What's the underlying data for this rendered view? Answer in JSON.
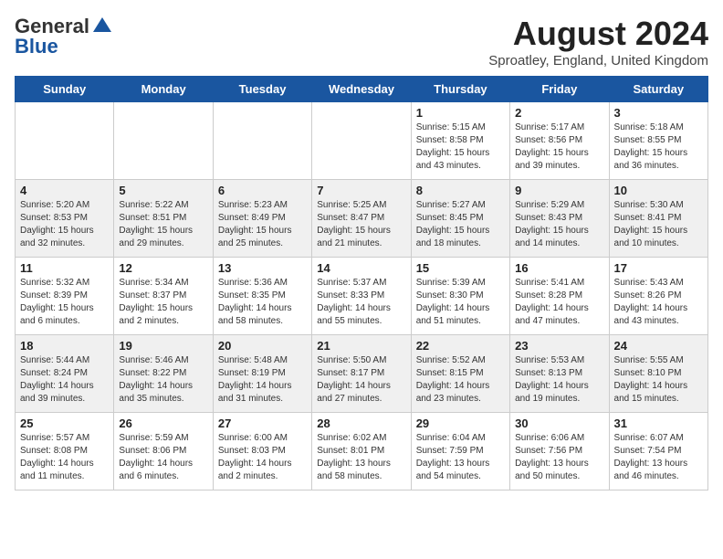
{
  "logo": {
    "general": "General",
    "blue": "Blue"
  },
  "title": "August 2024",
  "location": "Sproatley, England, United Kingdom",
  "days_of_week": [
    "Sunday",
    "Monday",
    "Tuesday",
    "Wednesday",
    "Thursday",
    "Friday",
    "Saturday"
  ],
  "weeks": [
    [
      {
        "day": "",
        "sunrise": "",
        "sunset": "",
        "daylight": ""
      },
      {
        "day": "",
        "sunrise": "",
        "sunset": "",
        "daylight": ""
      },
      {
        "day": "",
        "sunrise": "",
        "sunset": "",
        "daylight": ""
      },
      {
        "day": "",
        "sunrise": "",
        "sunset": "",
        "daylight": ""
      },
      {
        "day": "1",
        "sunrise": "Sunrise: 5:15 AM",
        "sunset": "Sunset: 8:58 PM",
        "daylight": "Daylight: 15 hours and 43 minutes."
      },
      {
        "day": "2",
        "sunrise": "Sunrise: 5:17 AM",
        "sunset": "Sunset: 8:56 PM",
        "daylight": "Daylight: 15 hours and 39 minutes."
      },
      {
        "day": "3",
        "sunrise": "Sunrise: 5:18 AM",
        "sunset": "Sunset: 8:55 PM",
        "daylight": "Daylight: 15 hours and 36 minutes."
      }
    ],
    [
      {
        "day": "4",
        "sunrise": "Sunrise: 5:20 AM",
        "sunset": "Sunset: 8:53 PM",
        "daylight": "Daylight: 15 hours and 32 minutes."
      },
      {
        "day": "5",
        "sunrise": "Sunrise: 5:22 AM",
        "sunset": "Sunset: 8:51 PM",
        "daylight": "Daylight: 15 hours and 29 minutes."
      },
      {
        "day": "6",
        "sunrise": "Sunrise: 5:23 AM",
        "sunset": "Sunset: 8:49 PM",
        "daylight": "Daylight: 15 hours and 25 minutes."
      },
      {
        "day": "7",
        "sunrise": "Sunrise: 5:25 AM",
        "sunset": "Sunset: 8:47 PM",
        "daylight": "Daylight: 15 hours and 21 minutes."
      },
      {
        "day": "8",
        "sunrise": "Sunrise: 5:27 AM",
        "sunset": "Sunset: 8:45 PM",
        "daylight": "Daylight: 15 hours and 18 minutes."
      },
      {
        "day": "9",
        "sunrise": "Sunrise: 5:29 AM",
        "sunset": "Sunset: 8:43 PM",
        "daylight": "Daylight: 15 hours and 14 minutes."
      },
      {
        "day": "10",
        "sunrise": "Sunrise: 5:30 AM",
        "sunset": "Sunset: 8:41 PM",
        "daylight": "Daylight: 15 hours and 10 minutes."
      }
    ],
    [
      {
        "day": "11",
        "sunrise": "Sunrise: 5:32 AM",
        "sunset": "Sunset: 8:39 PM",
        "daylight": "Daylight: 15 hours and 6 minutes."
      },
      {
        "day": "12",
        "sunrise": "Sunrise: 5:34 AM",
        "sunset": "Sunset: 8:37 PM",
        "daylight": "Daylight: 15 hours and 2 minutes."
      },
      {
        "day": "13",
        "sunrise": "Sunrise: 5:36 AM",
        "sunset": "Sunset: 8:35 PM",
        "daylight": "Daylight: 14 hours and 58 minutes."
      },
      {
        "day": "14",
        "sunrise": "Sunrise: 5:37 AM",
        "sunset": "Sunset: 8:33 PM",
        "daylight": "Daylight: 14 hours and 55 minutes."
      },
      {
        "day": "15",
        "sunrise": "Sunrise: 5:39 AM",
        "sunset": "Sunset: 8:30 PM",
        "daylight": "Daylight: 14 hours and 51 minutes."
      },
      {
        "day": "16",
        "sunrise": "Sunrise: 5:41 AM",
        "sunset": "Sunset: 8:28 PM",
        "daylight": "Daylight: 14 hours and 47 minutes."
      },
      {
        "day": "17",
        "sunrise": "Sunrise: 5:43 AM",
        "sunset": "Sunset: 8:26 PM",
        "daylight": "Daylight: 14 hours and 43 minutes."
      }
    ],
    [
      {
        "day": "18",
        "sunrise": "Sunrise: 5:44 AM",
        "sunset": "Sunset: 8:24 PM",
        "daylight": "Daylight: 14 hours and 39 minutes."
      },
      {
        "day": "19",
        "sunrise": "Sunrise: 5:46 AM",
        "sunset": "Sunset: 8:22 PM",
        "daylight": "Daylight: 14 hours and 35 minutes."
      },
      {
        "day": "20",
        "sunrise": "Sunrise: 5:48 AM",
        "sunset": "Sunset: 8:19 PM",
        "daylight": "Daylight: 14 hours and 31 minutes."
      },
      {
        "day": "21",
        "sunrise": "Sunrise: 5:50 AM",
        "sunset": "Sunset: 8:17 PM",
        "daylight": "Daylight: 14 hours and 27 minutes."
      },
      {
        "day": "22",
        "sunrise": "Sunrise: 5:52 AM",
        "sunset": "Sunset: 8:15 PM",
        "daylight": "Daylight: 14 hours and 23 minutes."
      },
      {
        "day": "23",
        "sunrise": "Sunrise: 5:53 AM",
        "sunset": "Sunset: 8:13 PM",
        "daylight": "Daylight: 14 hours and 19 minutes."
      },
      {
        "day": "24",
        "sunrise": "Sunrise: 5:55 AM",
        "sunset": "Sunset: 8:10 PM",
        "daylight": "Daylight: 14 hours and 15 minutes."
      }
    ],
    [
      {
        "day": "25",
        "sunrise": "Sunrise: 5:57 AM",
        "sunset": "Sunset: 8:08 PM",
        "daylight": "Daylight: 14 hours and 11 minutes."
      },
      {
        "day": "26",
        "sunrise": "Sunrise: 5:59 AM",
        "sunset": "Sunset: 8:06 PM",
        "daylight": "Daylight: 14 hours and 6 minutes."
      },
      {
        "day": "27",
        "sunrise": "Sunrise: 6:00 AM",
        "sunset": "Sunset: 8:03 PM",
        "daylight": "Daylight: 14 hours and 2 minutes."
      },
      {
        "day": "28",
        "sunrise": "Sunrise: 6:02 AM",
        "sunset": "Sunset: 8:01 PM",
        "daylight": "Daylight: 13 hours and 58 minutes."
      },
      {
        "day": "29",
        "sunrise": "Sunrise: 6:04 AM",
        "sunset": "Sunset: 7:59 PM",
        "daylight": "Daylight: 13 hours and 54 minutes."
      },
      {
        "day": "30",
        "sunrise": "Sunrise: 6:06 AM",
        "sunset": "Sunset: 7:56 PM",
        "daylight": "Daylight: 13 hours and 50 minutes."
      },
      {
        "day": "31",
        "sunrise": "Sunrise: 6:07 AM",
        "sunset": "Sunset: 7:54 PM",
        "daylight": "Daylight: 13 hours and 46 minutes."
      }
    ]
  ]
}
